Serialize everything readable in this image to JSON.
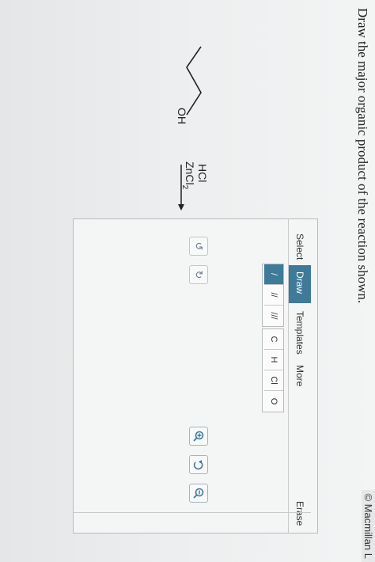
{
  "copyright": "© Macmillan L",
  "question": "Draw the major organic product of the reaction shown.",
  "reactant": {
    "oh_label": "OH"
  },
  "conditions": {
    "reagent_1": "HCl",
    "reagent_2_main": "ZnCl",
    "reagent_2_sub": "2"
  },
  "editor": {
    "menu": {
      "select": "Select",
      "draw": "Draw",
      "templates": "Templates",
      "more": "More",
      "erase": "Erase"
    },
    "bond_tools": [
      "/",
      "//",
      "///"
    ],
    "atom_tools": [
      "C",
      "H",
      "Cl",
      "O"
    ],
    "icons": {
      "undo": "undo-icon",
      "redo": "redo-icon",
      "zoom_in": "zoom-in-icon",
      "zoom_reset": "zoom-reset-icon",
      "zoom_out": "zoom-out-icon"
    },
    "accent_color": "#3f7a98"
  }
}
